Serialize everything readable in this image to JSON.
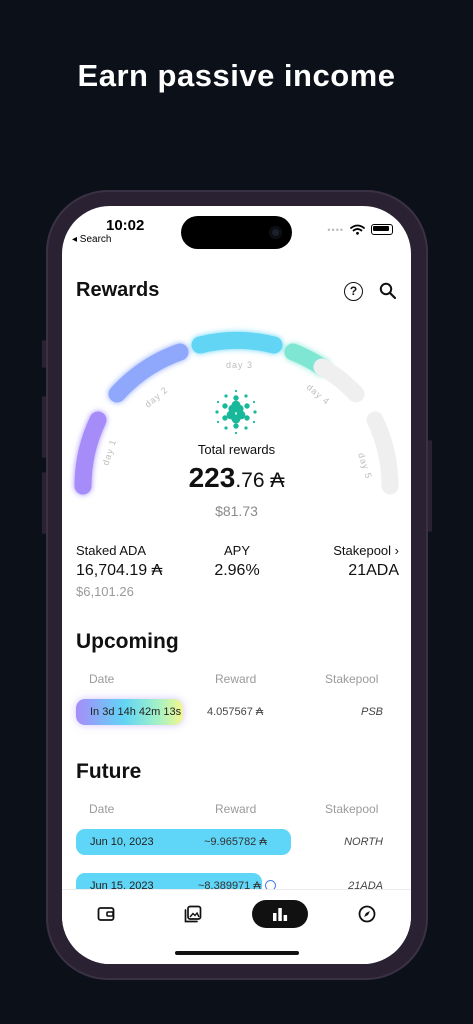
{
  "headline": "Earn passive income",
  "status": {
    "time": "10:02",
    "back": "◂ Search",
    "signal": "••••"
  },
  "header": {
    "title": "Rewards",
    "help": "?"
  },
  "gauge": {
    "days": [
      "day 1",
      "day 2",
      "day 3",
      "day 4",
      "day 5"
    ]
  },
  "rewards": {
    "total_label": "Total rewards",
    "total_whole": "223",
    "total_fraction": ".76 ₳",
    "total_usd": "$81.73"
  },
  "stats": {
    "staked_label": "Staked ADA",
    "staked_value": "16,704.19 ₳",
    "staked_usd": "$6,101.26",
    "apy_label": "APY",
    "apy_value": "2.96%",
    "stakepool_label": "Stakepool ›",
    "stakepool_value": "21ADA"
  },
  "upcoming": {
    "title": "Upcoming",
    "columns": [
      "Date",
      "Reward",
      "Stakepool"
    ],
    "rows": [
      {
        "date": "In 3d 14h 42m 13s",
        "reward": "4.057567 ₳",
        "pool": "PSB"
      }
    ]
  },
  "future": {
    "title": "Future",
    "columns": [
      "Date",
      "Reward",
      "Stakepool"
    ],
    "rows": [
      {
        "date": "Jun 10, 2023",
        "reward": "~9.965782 ₳",
        "pool": "NORTH"
      },
      {
        "date": "Jun 15, 2023",
        "reward": "~8.389971 ₳",
        "pool": "21ADA"
      }
    ]
  },
  "tabs": [
    "wallet-icon",
    "gallery-icon",
    "chart-icon",
    "compass-icon"
  ],
  "colors": {
    "background": "#0b1019",
    "accent_blue": "#5fd6f7",
    "accent_purple": "#a58cf8"
  }
}
